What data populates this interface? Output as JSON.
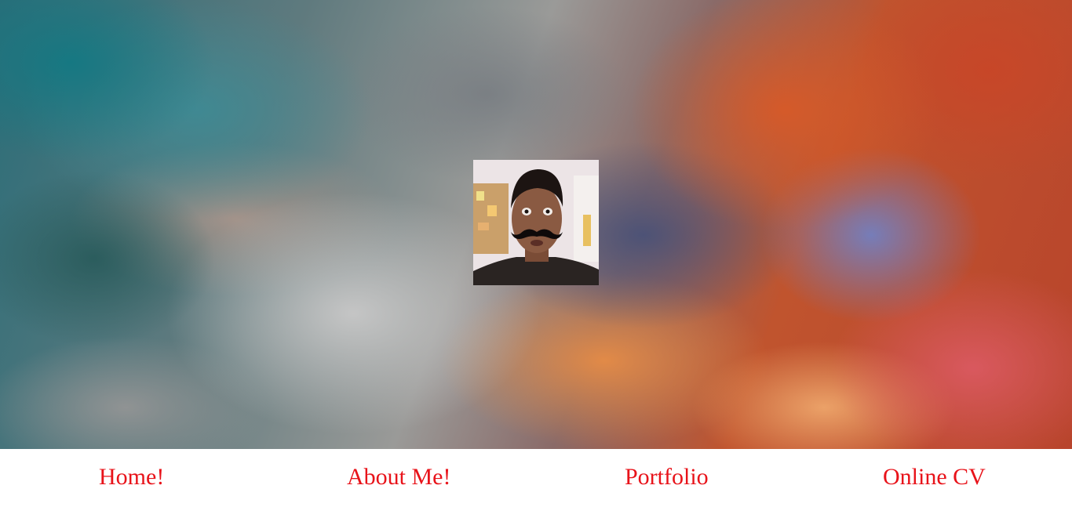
{
  "nav": {
    "items": [
      {
        "label": "Home!"
      },
      {
        "label": "About Me!"
      },
      {
        "label": "Portfolio"
      },
      {
        "label": "Online CV"
      }
    ],
    "link_color": "#e8131a"
  },
  "hero": {
    "background": "abstract-colorful-smoke-painting",
    "avatar": "profile-photo-with-mustache"
  }
}
